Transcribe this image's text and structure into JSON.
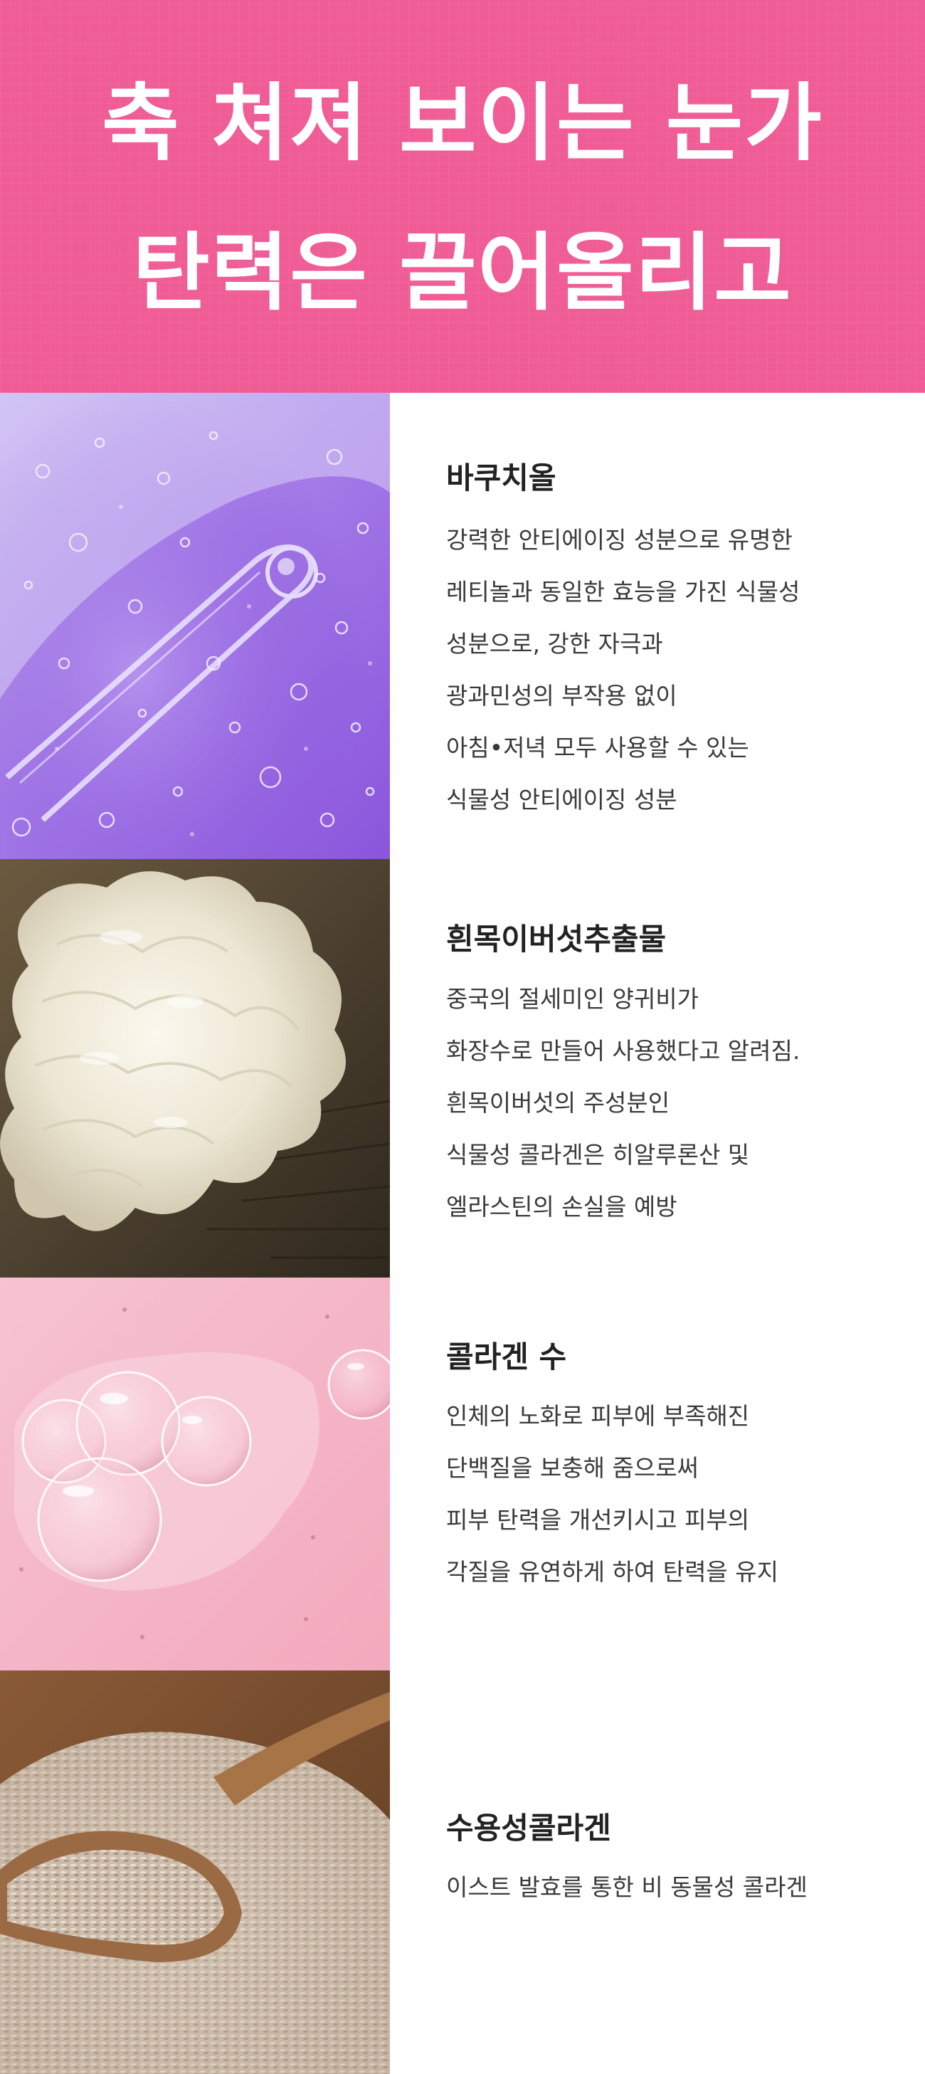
{
  "hero": {
    "line1": "축 쳐져 보이는 눈가",
    "line2": "탄력은 끌어올리고"
  },
  "colors": {
    "hero_background": "#ef5c96",
    "title_text": "#222222",
    "body_text": "#3a3a3a",
    "divider": "#e3e3e3"
  },
  "ingredients": [
    {
      "title": "바쿠치올",
      "image": "purple-serum-dropper-image",
      "lines": [
        "강력한 안티에이징 성분으로 유명한",
        "레티놀과 동일한 효능을 가진 식물성",
        "성분으로, 강한 자극과",
        "광과민성의 부작용 없이",
        "아침•저녁 모두 사용할 수 있는",
        "식물성 안티에이징 성분"
      ]
    },
    {
      "title": "흰목이버섯추출물",
      "image": "white-fungus-on-wood-image",
      "lines": [
        "중국의 절세미인 양귀비가",
        "화장수로 만들어 사용했다고 알려짐.",
        "흰목이버섯의 주성분인",
        "식물성 콜라겐은 히알루론산 및",
        "엘라스틴의 손실을 예방"
      ]
    },
    {
      "title": "콜라겐 수",
      "image": "pink-gel-bubbles-image",
      "lines": [
        "인체의 노화로 피부에 부족해진",
        "단백질을 보충해 줌으로써",
        "피부 탄력을 개선키시고 피부의",
        "각질을 유연하게 하여 탄력을 유지"
      ]
    },
    {
      "title": "수용성콜라겐",
      "image": "yeast-granules-wooden-spoon-image",
      "lines": [
        "이스트 발효를 통한 비 동물성 콜라겐"
      ]
    }
  ]
}
